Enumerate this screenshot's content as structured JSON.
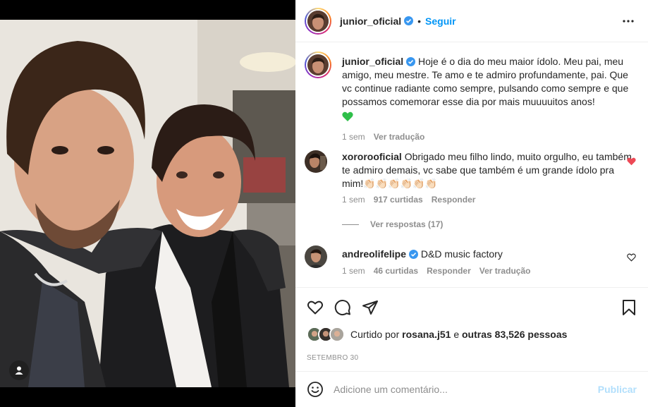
{
  "post": {
    "author": "junior_oficial",
    "follow_label": "Seguir",
    "separator": "•",
    "caption": "Hoje é o dia do meu maior ídolo. Meu pai, meu amigo, meu mestre. Te amo e te admiro profundamente, pai. Que vc continue radiante como sempre, pulsando como sempre e que possamos comemorar esse dia por mais muuuuitos anos!",
    "caption_emoji": "💚",
    "caption_time": "1 sem",
    "caption_translate": "Ver tradução"
  },
  "comments": [
    {
      "username": "xororooficial",
      "text": "Obrigado meu filho lindo, muito orgulho, eu também te admiro demais, vc sabe que também é um grande ídolo pra mim!",
      "emojis": "👏🏻👏🏻👏🏻👏🏻👏🏻👏🏻",
      "time": "1 sem",
      "likes": "917 curtidas",
      "reply": "Responder",
      "view_replies": "Ver respostas (17)",
      "liked": true
    },
    {
      "username": "andreolifelipe",
      "text": "D&D music factory",
      "time": "1 sem",
      "likes": "46 curtidas",
      "reply": "Responder",
      "translate": "Ver tradução",
      "liked": false
    }
  ],
  "likes": {
    "prefix": "Curtido por",
    "user": "rosana.j51",
    "middle": "e",
    "others": "outras 83,526 pessoas"
  },
  "date": "SETEMBRO 30",
  "add_comment": {
    "placeholder": "Adicione um comentário...",
    "publish": "Publicar"
  },
  "colors": {
    "accent": "#0095f6",
    "verified": "#3897f0",
    "liked_heart": "#ed4956",
    "publish_disabled": "#b2dffc",
    "caption_heart": "#2fbf4a"
  },
  "icons": [
    "verified-badge-icon",
    "more-options-icon",
    "heart-icon",
    "comment-icon",
    "share-icon",
    "save-icon",
    "emoji-icon",
    "user-tag-icon"
  ]
}
